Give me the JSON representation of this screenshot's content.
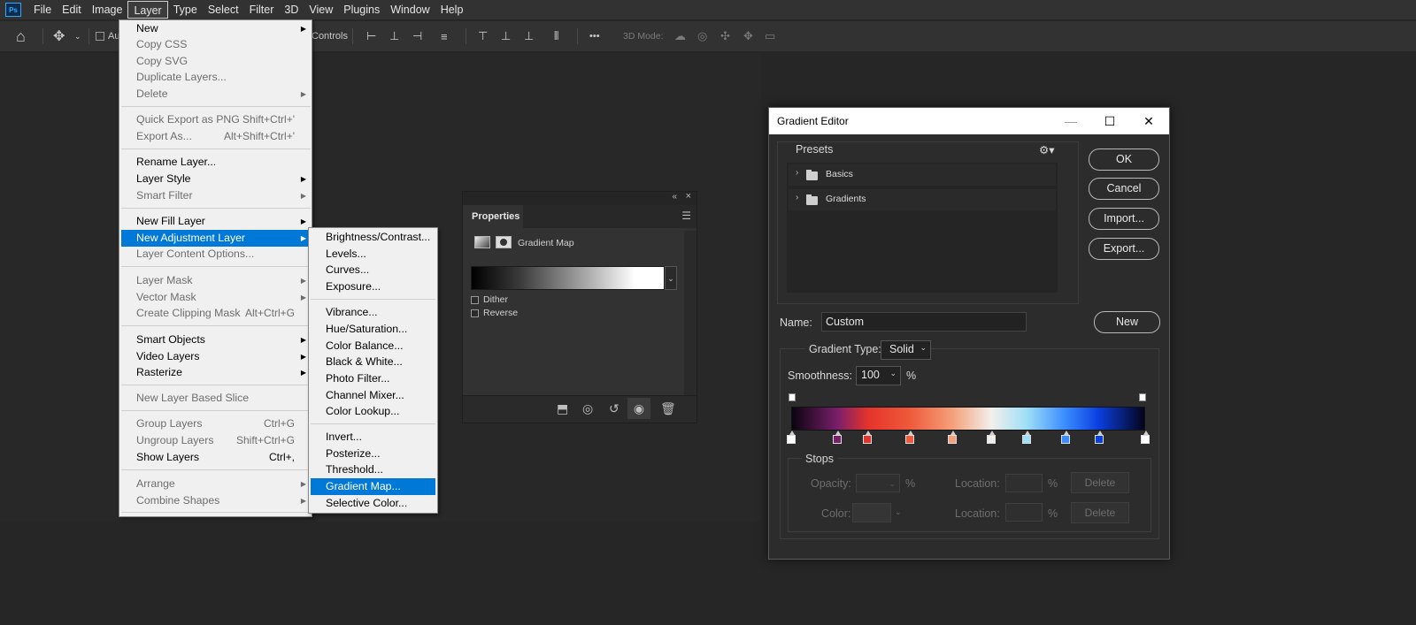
{
  "menubar": {
    "items": [
      "File",
      "Edit",
      "Image",
      "Layer",
      "Type",
      "Select",
      "Filter",
      "3D",
      "View",
      "Plugins",
      "Window",
      "Help"
    ],
    "active": "Layer",
    "logo": "Ps"
  },
  "options_bar": {
    "auto_label": "Au",
    "controls_label": "Controls",
    "mode_3d_label": "3D Mode:",
    "more_label": "•••"
  },
  "layer_menu": {
    "items": [
      {
        "label": "New",
        "shortcut": "",
        "submenu": true,
        "disabled": false
      },
      {
        "label": "Copy CSS",
        "shortcut": "",
        "submenu": false,
        "disabled": true
      },
      {
        "label": "Copy SVG",
        "shortcut": "",
        "submenu": false,
        "disabled": true
      },
      {
        "label": "Duplicate Layers...",
        "shortcut": "",
        "submenu": false,
        "disabled": true
      },
      {
        "label": "Delete",
        "shortcut": "",
        "submenu": true,
        "disabled": true
      },
      {
        "label": "Quick Export as PNG",
        "shortcut": "Shift+Ctrl+'",
        "submenu": false,
        "disabled": true
      },
      {
        "label": "Export As...",
        "shortcut": "Alt+Shift+Ctrl+'",
        "submenu": false,
        "disabled": true
      },
      {
        "label": "Rename Layer...",
        "shortcut": "",
        "submenu": false,
        "disabled": false
      },
      {
        "label": "Layer Style",
        "shortcut": "",
        "submenu": true,
        "disabled": false
      },
      {
        "label": "Smart Filter",
        "shortcut": "",
        "submenu": true,
        "disabled": true
      },
      {
        "label": "New Fill Layer",
        "shortcut": "",
        "submenu": true,
        "disabled": false
      },
      {
        "label": "New Adjustment Layer",
        "shortcut": "",
        "submenu": true,
        "disabled": false,
        "highlighted": true
      },
      {
        "label": "Layer Content Options...",
        "shortcut": "",
        "submenu": false,
        "disabled": true
      },
      {
        "label": "Layer Mask",
        "shortcut": "",
        "submenu": true,
        "disabled": true
      },
      {
        "label": "Vector Mask",
        "shortcut": "",
        "submenu": true,
        "disabled": true
      },
      {
        "label": "Create Clipping Mask",
        "shortcut": "Alt+Ctrl+G",
        "submenu": false,
        "disabled": true
      },
      {
        "label": "Smart Objects",
        "shortcut": "",
        "submenu": true,
        "disabled": false
      },
      {
        "label": "Video Layers",
        "shortcut": "",
        "submenu": true,
        "disabled": false
      },
      {
        "label": "Rasterize",
        "shortcut": "",
        "submenu": true,
        "disabled": false
      },
      {
        "label": "New Layer Based Slice",
        "shortcut": "",
        "submenu": false,
        "disabled": true
      },
      {
        "label": "Group Layers",
        "shortcut": "Ctrl+G",
        "submenu": false,
        "disabled": true
      },
      {
        "label": "Ungroup Layers",
        "shortcut": "Shift+Ctrl+G",
        "submenu": false,
        "disabled": true
      },
      {
        "label": "Show Layers",
        "shortcut": "Ctrl+,",
        "submenu": false,
        "disabled": false
      },
      {
        "label": "Arrange",
        "shortcut": "",
        "submenu": true,
        "disabled": true
      },
      {
        "label": "Combine Shapes",
        "shortcut": "",
        "submenu": true,
        "disabled": true
      }
    ]
  },
  "adjustment_menu": {
    "items": [
      {
        "label": "Brightness/Contrast..."
      },
      {
        "label": "Levels..."
      },
      {
        "label": "Curves..."
      },
      {
        "label": "Exposure..."
      },
      {
        "label": "Vibrance..."
      },
      {
        "label": "Hue/Saturation..."
      },
      {
        "label": "Color Balance..."
      },
      {
        "label": "Black & White..."
      },
      {
        "label": "Photo Filter..."
      },
      {
        "label": "Channel Mixer..."
      },
      {
        "label": "Color Lookup..."
      },
      {
        "label": "Invert..."
      },
      {
        "label": "Posterize..."
      },
      {
        "label": "Threshold..."
      },
      {
        "label": "Gradient Map...",
        "highlighted": true
      },
      {
        "label": "Selective Color..."
      }
    ]
  },
  "properties_panel": {
    "tab": "Properties",
    "adjustment_name": "Gradient Map",
    "dither_label": "Dither",
    "reverse_label": "Reverse",
    "dither_checked": false,
    "reverse_checked": false,
    "collapse_glyph": "«",
    "close_glyph": "×"
  },
  "gradient_editor": {
    "title": "Gradient Editor",
    "presets_label": "Presets",
    "preset_folders": [
      "Basics",
      "Gradients"
    ],
    "buttons": {
      "ok": "OK",
      "cancel": "Cancel",
      "import": "Import...",
      "export": "Export...",
      "new": "New"
    },
    "name_label": "Name:",
    "name_value": "Custom",
    "gradient_type_label": "Gradient Type:",
    "gradient_type_value": "Solid",
    "smoothness_label": "Smoothness:",
    "smoothness_value": "100",
    "smoothness_unit": "%",
    "stops_label": "Stops",
    "opacity_label": "Opacity:",
    "color_label": "Color:",
    "location_label": "Location:",
    "percent": "%",
    "delete_label": "Delete",
    "gradient_colors": [
      "#0a0410",
      "#7a1f6b",
      "#e4332b",
      "#ef5a3a",
      "#f4a07a",
      "#f2efea",
      "#9fe0f6",
      "#3b8cff",
      "#0a3fe0",
      "#04041a"
    ],
    "color_stop_positions": [
      0.0,
      0.13,
      0.215,
      0.335,
      0.455,
      0.565,
      0.665,
      0.775,
      0.87,
      1.0
    ]
  }
}
